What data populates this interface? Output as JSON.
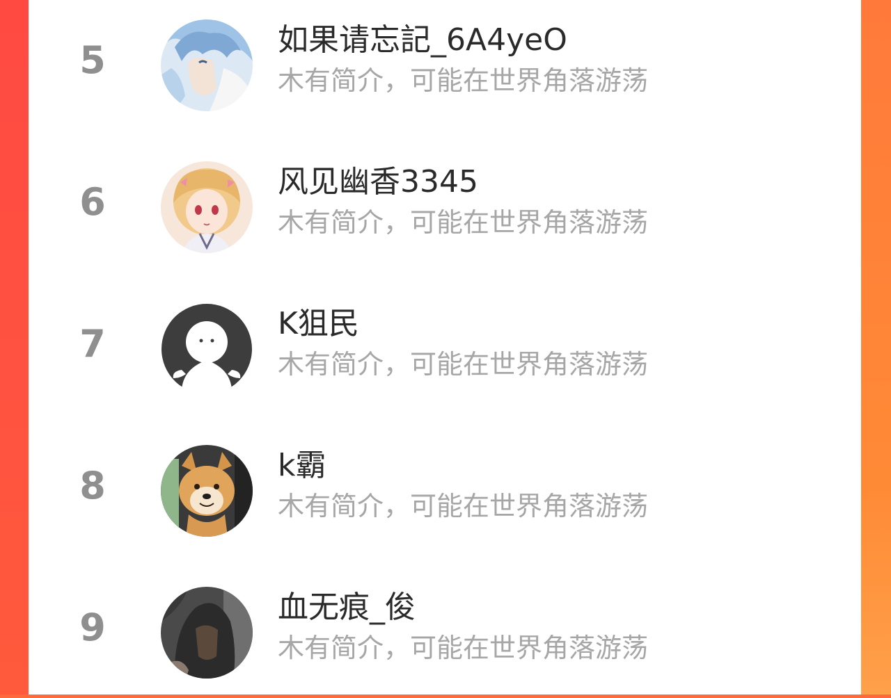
{
  "users": [
    {
      "rank": "5",
      "name": "如果请忘記_6A4yeO",
      "bio": "木有简介，可能在世界角落游荡",
      "avatar": "anime-boy-avatar"
    },
    {
      "rank": "6",
      "name": "风见幽香3345",
      "bio": "木有简介，可能在世界角落游荡",
      "avatar": "anime-girl-avatar"
    },
    {
      "rank": "7",
      "name": "K狙民",
      "bio": "木有简介，可能在世界角落游荡",
      "avatar": "default-ghost-avatar"
    },
    {
      "rank": "8",
      "name": "k霸",
      "bio": "木有简介，可能在世界角落游荡",
      "avatar": "shiba-dog-avatar"
    },
    {
      "rank": "9",
      "name": "血无痕_俊",
      "bio": "木有简介，可能在世界角落游荡",
      "avatar": "dark-hooded-figure-avatar"
    }
  ],
  "colors": {
    "left_border": "#ff4a42",
    "right_border": "#ff8a36",
    "rank_text": "#8f8f8f",
    "name_text": "#2a2a2a",
    "bio_text": "#a6a6a6"
  }
}
